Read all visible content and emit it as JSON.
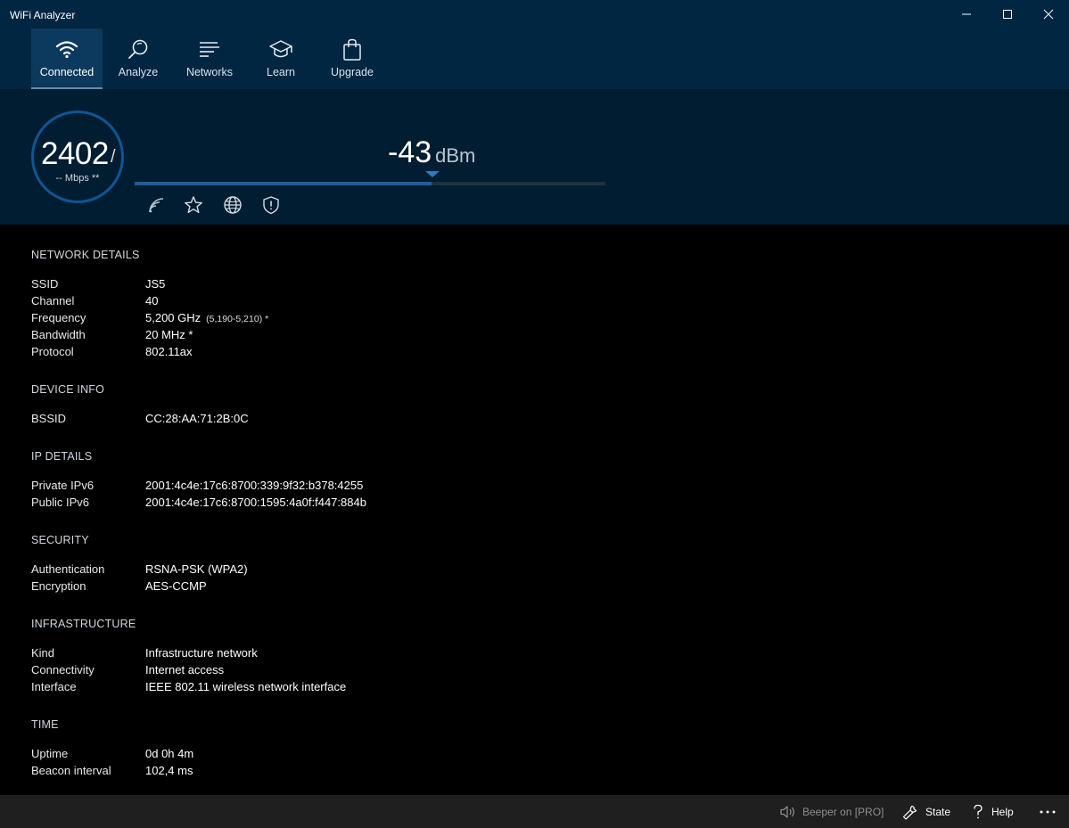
{
  "window": {
    "title": "WiFi Analyzer",
    "controls": [
      "minimize-icon",
      "maximize-icon",
      "close-icon"
    ]
  },
  "nav": {
    "tabs": [
      {
        "label": "Connected",
        "icon": "wifi-icon",
        "active": true
      },
      {
        "label": "Analyze",
        "icon": "magnifier-icon",
        "active": false
      },
      {
        "label": "Networks",
        "icon": "list-icon",
        "active": false
      },
      {
        "label": "Learn",
        "icon": "mortarboard-icon",
        "active": false
      },
      {
        "label": "Upgrade",
        "icon": "shopping-bag-icon",
        "active": false
      }
    ]
  },
  "signal": {
    "link_speed": "2402",
    "slash": "/",
    "mbps_label": "-- Mbps **",
    "dbm_value": "-43",
    "dbm_unit": "dBm",
    "strength_fraction": 0.63,
    "icons": [
      "signal-strength-icon",
      "favorite-star-icon",
      "globe-icon",
      "shield-icon"
    ]
  },
  "sections": {
    "network": {
      "title": "NETWORK DETAILS",
      "rows": [
        {
          "key": "SSID",
          "value": "JS5"
        },
        {
          "key": "Channel",
          "value": "40"
        },
        {
          "key": "Frequency",
          "value": "5,200 GHz",
          "sub": "(5,190-5,210) *"
        },
        {
          "key": "Bandwidth",
          "value": "20 MHz *"
        },
        {
          "key": "Protocol",
          "value": "802.11ax"
        }
      ]
    },
    "device": {
      "title": "DEVICE INFO",
      "rows": [
        {
          "key": "BSSID",
          "value": "CC:28:AA:71:2B:0C"
        }
      ]
    },
    "ip": {
      "title": "IP DETAILS",
      "rows": [
        {
          "key": "Private IPv6",
          "value": "2001:4c4e:17c6:8700:339:9f32:b378:4255"
        },
        {
          "key": "Public IPv6",
          "value": "2001:4c4e:17c6:8700:1595:4a0f:f447:884b"
        }
      ]
    },
    "security": {
      "title": "SECURITY",
      "rows": [
        {
          "key": "Authentication",
          "value": "RSNA-PSK (WPA2)"
        },
        {
          "key": "Encryption",
          "value": "AES-CCMP"
        }
      ]
    },
    "infrastructure": {
      "title": "INFRASTRUCTURE",
      "rows": [
        {
          "key": "Kind",
          "value": "Infrastructure network"
        },
        {
          "key": "Connectivity",
          "value": "Internet access"
        },
        {
          "key": "Interface",
          "value": "IEEE 802.11 wireless network interface"
        }
      ]
    },
    "time": {
      "title": "TIME",
      "rows": [
        {
          "key": "Uptime",
          "value": "0d 0h 4m"
        },
        {
          "key": "Beacon interval",
          "value": "102,4 ms"
        }
      ]
    }
  },
  "statusbar": {
    "beeper": "Beeper on [PRO]",
    "state": "State",
    "help": "Help",
    "more_icon": "more-icon"
  },
  "colors": {
    "header_bg": "#002642",
    "signal_bg": "#011d31",
    "accent": "#1a5f9e",
    "statusbar_bg": "#1f1f1f"
  }
}
